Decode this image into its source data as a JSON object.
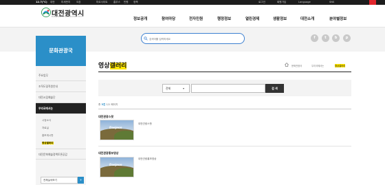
{
  "topbar": {
    "weather": "12.7(°C)",
    "items_left": [
      "대전",
      "미세먼지",
      "오존",
      "미르사이트",
      "홈우스",
      "민원",
      "정책"
    ],
    "items_right": [
      "로그인",
      "회원가입",
      "Language",
      "SNS"
    ]
  },
  "header": {
    "logo_text": "대전광역시",
    "logo_sub": "DAEJEON METROPOLITAN CITY",
    "nav": [
      "정보공개",
      "참여마당",
      "전자민원",
      "행정정보",
      "열린경제",
      "생활정보",
      "대전소개",
      "분야별정보"
    ]
  },
  "search": {
    "placeholder": "검색어를 입력하세요"
  },
  "sns": [
    "f",
    "t",
    "b",
    "p"
  ],
  "sidebar": {
    "title": "문화관광국",
    "items": [
      {
        "label": "주요업무"
      },
      {
        "label": "조직도및직원안내"
      },
      {
        "label": "대전시립예술단"
      },
      {
        "label": "우리국에서는"
      }
    ],
    "subitems": [
      "시정소식",
      "자료실",
      "홍보게시판",
      "영상갤러리"
    ],
    "last_item": "대전문화예술정책토론공감",
    "select_label": "전체실국보기",
    "select_btn": "+"
  },
  "page": {
    "title_a": "영상",
    "title_b": "갤러리",
    "breadcrumb": [
      "문화관광국",
      "우리국에서는",
      "영상갤러리"
    ]
  },
  "filter": {
    "select_value": "전체",
    "button": "검 색"
  },
  "results": {
    "count_label": "총",
    "count": "3건",
    "pages": "1/1 페이지"
  },
  "items": [
    {
      "title": "대전관광스팟",
      "caption": "대전관광스팟",
      "thumb_text": "Daejeon"
    },
    {
      "title": "대전관광홍보영상",
      "caption": "대전관광홍보영상",
      "thumb_text": "Daejeon"
    }
  ]
}
